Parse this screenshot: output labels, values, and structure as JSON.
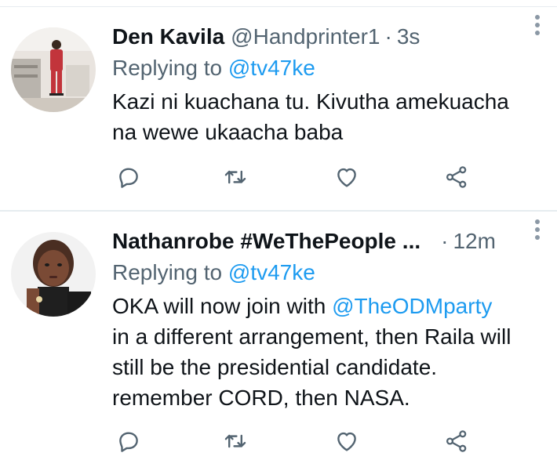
{
  "tweets": [
    {
      "display_name": "Den Kavila",
      "handle": "@Handprinter1",
      "separator": "·",
      "timestamp": "3s",
      "replying_prefix": "Replying to",
      "replying_to": "@tv47ke",
      "text_lines": [
        "Kazi ni kuachana tu. Kivutha amekuacha",
        "na wewe ukaacha baba"
      ]
    },
    {
      "display_name": "Nathanrobe #WeThePeople ...",
      "handle": "",
      "separator": "·",
      "timestamp": "12m",
      "replying_prefix": "Replying to",
      "replying_to": "@tv47ke",
      "text_line1_prefix": "OKA will now join with ",
      "text_line1_mention": "@TheODMparty",
      "text_lines_rest": [
        "in a different arrangement, then Raila will",
        "still be the presidential candidate.",
        "remember CORD, then NASA."
      ]
    }
  ],
  "icons": {
    "reply": "reply-icon",
    "retweet": "retweet-icon",
    "like": "like-icon",
    "share": "share-icon",
    "more": "more-icon"
  },
  "colors": {
    "accent": "#1d9bf0",
    "secondary_text": "#536471",
    "icon": "#536471",
    "divider": "#e6ecf0"
  }
}
